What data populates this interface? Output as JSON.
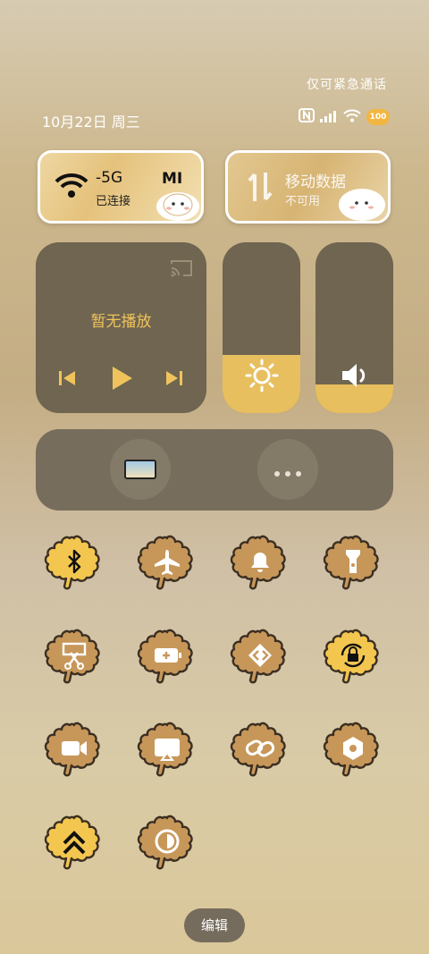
{
  "status": {
    "emergency_text": "仅可紧急通话",
    "date_text": "10月22日 周三",
    "battery_text": "100"
  },
  "wifi_card": {
    "title": "-5G",
    "status": "已连接",
    "extra_label": "MI"
  },
  "mobile_card": {
    "title": "移动数据",
    "status": "不可用"
  },
  "media": {
    "no_playback_text": "暂无播放"
  },
  "sliders": {
    "brightness_level": 0.34,
    "volume_level": 0.17
  },
  "quick_buttons": [
    "screen-display-button",
    "more-options-button"
  ],
  "toggles": [
    {
      "name": "bluetooth",
      "icon": "bluetooth-icon",
      "active": true
    },
    {
      "name": "airplane",
      "icon": "airplane-icon",
      "active": false
    },
    {
      "name": "ringer",
      "icon": "bell-icon",
      "active": false
    },
    {
      "name": "flashlight",
      "icon": "flashlight-icon",
      "active": false
    },
    {
      "name": "screenshot",
      "icon": "scissors-icon",
      "active": false
    },
    {
      "name": "battery-saver",
      "icon": "battery-plus-icon",
      "active": false
    },
    {
      "name": "dynamic-island",
      "icon": "code-arrows-icon",
      "active": false
    },
    {
      "name": "rotation-lock",
      "icon": "rotation-lock-icon",
      "active": true
    },
    {
      "name": "screen-record",
      "icon": "video-camera-icon",
      "active": false
    },
    {
      "name": "cast",
      "icon": "cast-screen-icon",
      "active": false
    },
    {
      "name": "link",
      "icon": "link-icon",
      "active": false
    },
    {
      "name": "settings",
      "icon": "hexagon-gear-icon",
      "active": false
    },
    {
      "name": "performance",
      "icon": "double-chevron-up-icon",
      "active": true
    },
    {
      "name": "dark-mode",
      "icon": "contrast-icon",
      "active": false
    }
  ],
  "edit_label": "编辑",
  "colors": {
    "active_leaf": "#f3c64f",
    "inactive_leaf": "#c7975a",
    "tile_dark": "#6f6550",
    "accent": "#e8bf5f"
  }
}
